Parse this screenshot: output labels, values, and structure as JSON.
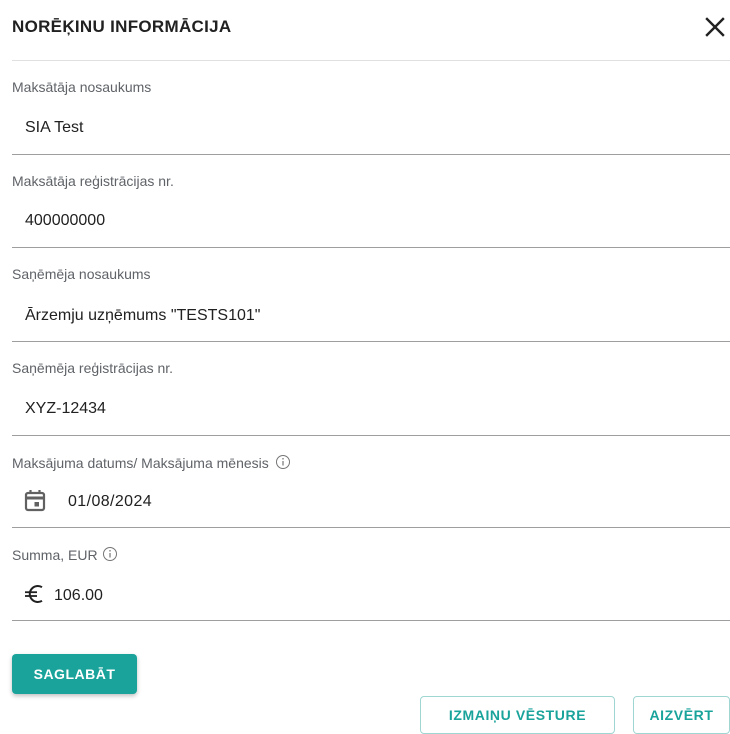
{
  "dialog": {
    "title": "NORĒĶINU INFORMĀCIJA",
    "close_icon": "close-icon"
  },
  "fields": {
    "payer_name": {
      "label": "Maksātāja nosaukums",
      "value": "SIA Test"
    },
    "payer_reg": {
      "label": "Maksātāja reģistrācijas nr.",
      "value": "400000000"
    },
    "receiver_name": {
      "label": "Saņēmēja nosaukums",
      "value": "Ārzemju uzņēmums \"TESTS101\""
    },
    "receiver_reg": {
      "label": "Saņēmēja reģistrācijas nr.",
      "value": "XYZ-12434"
    },
    "payment_date": {
      "label": "Maksājuma datums/ Maksājuma mēnesis",
      "value": "01/08/2024",
      "prefix_icon": "calendar-icon",
      "suffix_icon": "info-icon"
    },
    "amount": {
      "label": "Summa, EUR",
      "value": "106.00",
      "prefix_icon": "euro-icon",
      "suffix_icon": "info-icon"
    }
  },
  "actions": {
    "save_label": "SAGLABĀT",
    "history_label": "IZMAIŅU VĒSTURE",
    "close_label": "AIZVĒRT"
  },
  "colors": {
    "accent": "#1aa39b",
    "outline_border": "#9fd6d2",
    "label": "#5f6368",
    "text": "#212121"
  }
}
